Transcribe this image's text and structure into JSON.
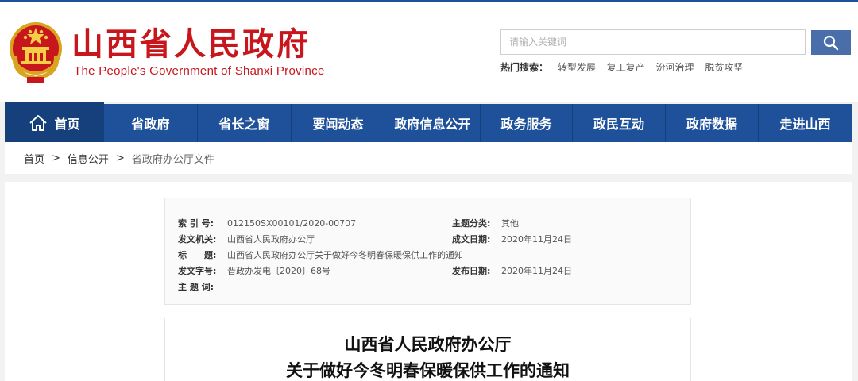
{
  "header": {
    "title": "山西省人民政府",
    "subtitle": "The People's Government of Shanxi Province",
    "emblem_icon": "national-emblem-icon",
    "search": {
      "placeholder": "请输入关键词",
      "value": "",
      "button_icon": "search-icon"
    },
    "hot_searches": {
      "label": "热门搜索：",
      "items": [
        "转型发展",
        "复工复产",
        "汾河治理",
        "脱贫攻坚"
      ]
    }
  },
  "nav": {
    "items": [
      {
        "label": "首页",
        "icon": "home-icon"
      },
      {
        "label": "省政府"
      },
      {
        "label": "省长之窗"
      },
      {
        "label": "要闻动态"
      },
      {
        "label": "政府信息公开"
      },
      {
        "label": "政务服务"
      },
      {
        "label": "政民互动"
      },
      {
        "label": "政府数据"
      },
      {
        "label": "走进山西"
      }
    ]
  },
  "breadcrumb": {
    "items": [
      "首页",
      "信息公开",
      "省政府办公厅文件"
    ],
    "separator": ">"
  },
  "meta": {
    "index_key": "索 引 号:",
    "index_value": "012150SX00101/2020-00707",
    "category_key": "主题分类:",
    "category_value": "其他",
    "issuer_key": "发文机关:",
    "issuer_value": "山西省人民政府办公厅",
    "created_key": "成文日期:",
    "created_value": "2020年11月24日",
    "title_key": "标　　题:",
    "title_value": "山西省人民政府办公厅关于做好今冬明春保暖保供工作的通知",
    "docno_key": "发文字号:",
    "docno_value": "晋政办发电〔2020〕68号",
    "published_key": "发布日期:",
    "published_value": "2020年11月24日",
    "keywords_key": "主 题 词:",
    "keywords_value": ""
  },
  "document": {
    "title_line1": "山西省人民政府办公厅",
    "title_line2": "关于做好今冬明春保暖保供工作的通知"
  },
  "colors": {
    "brand_red": "#c8161d",
    "nav_blue": "#1e5199",
    "nav_active": "#15407b",
    "search_button": "#4a6ea9"
  }
}
